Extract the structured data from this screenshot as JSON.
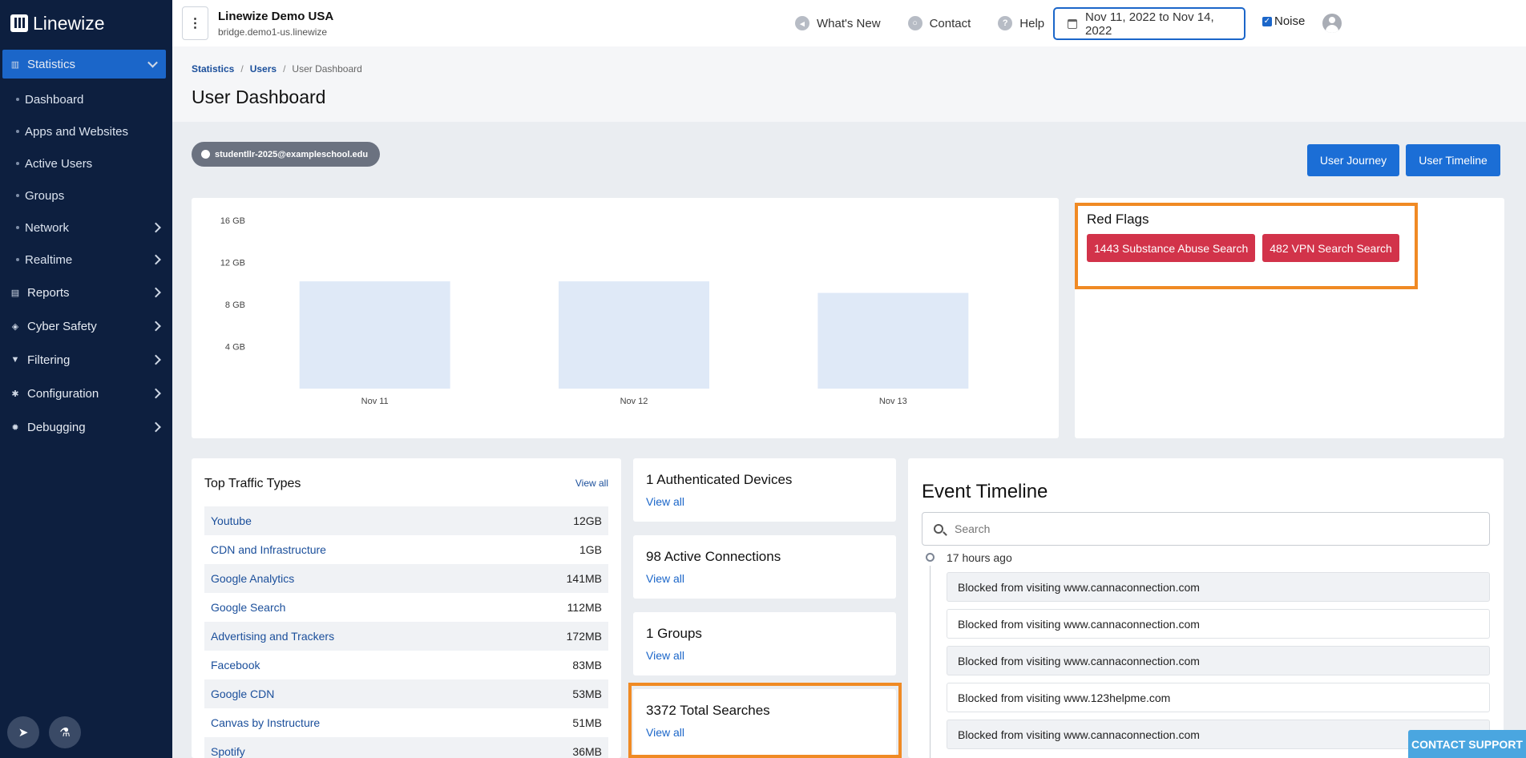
{
  "brand": "Linewize",
  "org": {
    "name": "Linewize Demo USA",
    "host": "bridge.demo1-us.linewize"
  },
  "top_links": [
    {
      "label": "What's New",
      "icon": "megaphone-icon"
    },
    {
      "label": "Contact",
      "icon": "chat-icon"
    },
    {
      "label": "Help",
      "icon": "help-icon",
      "glyph": "?"
    }
  ],
  "date_range": "Nov 11, 2022 to Nov 14, 2022",
  "noise_label": "Noise",
  "noise_checked": true,
  "sidebar": {
    "active": {
      "label": "Statistics"
    },
    "sub_items": [
      {
        "label": "Dashboard"
      },
      {
        "label": "Apps and Websites"
      },
      {
        "label": "Active Users"
      },
      {
        "label": "Groups"
      },
      {
        "label": "Network",
        "expandable": true
      },
      {
        "label": "Realtime",
        "expandable": true
      }
    ],
    "items": [
      {
        "label": "Reports",
        "icon": "document-icon"
      },
      {
        "label": "Cyber Safety",
        "icon": "shield-icon"
      },
      {
        "label": "Filtering",
        "icon": "funnel-icon"
      },
      {
        "label": "Configuration",
        "icon": "gear-icon"
      },
      {
        "label": "Debugging",
        "icon": "bug-icon"
      }
    ]
  },
  "breadcrumb": {
    "items": [
      "Statistics",
      "Users"
    ],
    "current": "User Dashboard"
  },
  "page_title": "User Dashboard",
  "user_chip": "studentllr-2025@exampleschool.edu",
  "buttons": {
    "journey": "User Journey",
    "timeline": "User Timeline"
  },
  "chart_data": {
    "type": "bar",
    "categories": [
      "Nov 11",
      "Nov 12",
      "Nov 13"
    ],
    "values": [
      10.2,
      10.2,
      9.1
    ],
    "ytick_labels": [
      "16 GB",
      "12 GB",
      "8 GB",
      "4 GB"
    ],
    "yticks": [
      16,
      12,
      8,
      4
    ],
    "ylim": [
      0,
      16
    ],
    "unit": "GB",
    "bar_color": "#dfe9f7"
  },
  "red_flags": {
    "title": "Red Flags",
    "badges": [
      "1443 Substance Abuse Search",
      "482 VPN Search Search"
    ]
  },
  "top_traffic": {
    "title": "Top Traffic Types",
    "view_all": "View all",
    "rows": [
      {
        "name": "Youtube",
        "value": "12GB"
      },
      {
        "name": "CDN and Infrastructure",
        "value": "1GB"
      },
      {
        "name": "Google Analytics",
        "value": "141MB"
      },
      {
        "name": "Google Search",
        "value": "112MB"
      },
      {
        "name": "Advertising and Trackers",
        "value": "172MB"
      },
      {
        "name": "Facebook",
        "value": "83MB"
      },
      {
        "name": "Google CDN",
        "value": "53MB"
      },
      {
        "name": "Canvas by Instructure",
        "value": "51MB"
      },
      {
        "name": "Spotify",
        "value": "36MB"
      }
    ]
  },
  "stats": [
    {
      "value": "1 Authenticated Devices",
      "link": "View all"
    },
    {
      "value": "98 Active Connections",
      "link": "View all"
    },
    {
      "value": "1 Groups",
      "link": "View all"
    },
    {
      "value": "3372 Total Searches",
      "link": "View all"
    }
  ],
  "timeline": {
    "title": "Event Timeline",
    "search_placeholder": "Search",
    "time": "17 hours ago",
    "events": [
      "Blocked from visiting www.cannaconnection.com",
      "Blocked from visiting www.cannaconnection.com",
      "Blocked from visiting www.cannaconnection.com",
      "Blocked from visiting www.123helpme.com",
      "Blocked from visiting www.cannaconnection.com"
    ]
  },
  "contact_support": "CONTACT SUPPORT",
  "colors": {
    "sidebar": "#0d1f3f",
    "accent": "#1b66c9",
    "red_flag": "#d2334a",
    "highlight": "#f08a24"
  }
}
